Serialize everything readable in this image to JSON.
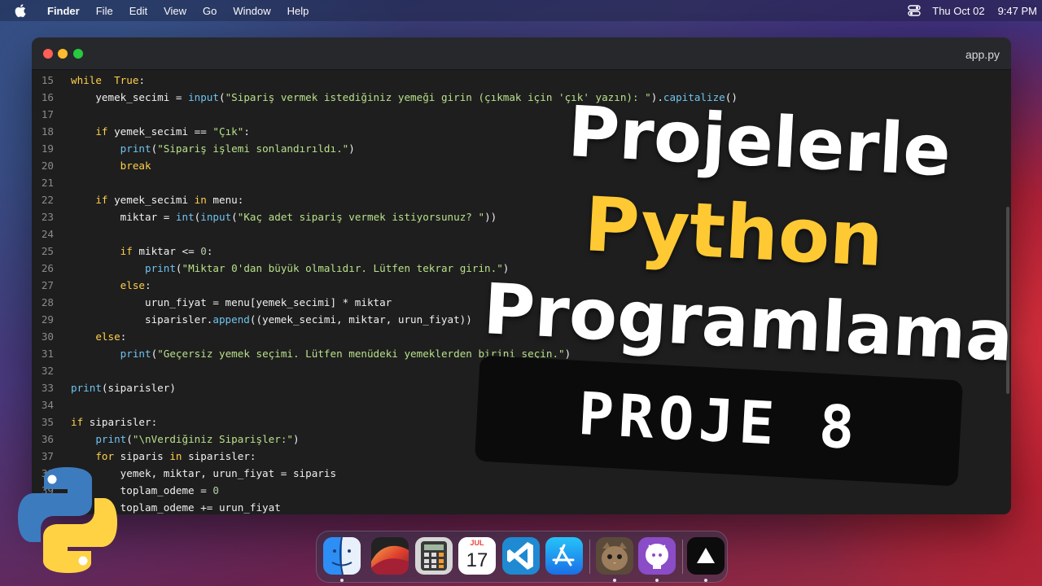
{
  "menubar": {
    "app_name": "Finder",
    "items": [
      "File",
      "Edit",
      "View",
      "Go",
      "Window",
      "Help"
    ],
    "date": "Thu Oct 02",
    "time": "9:47 PM"
  },
  "window": {
    "filename": "app.py"
  },
  "code_lines": [
    {
      "num": "15",
      "tokens": [
        [
          "kw",
          "while"
        ],
        [
          "",
          "  "
        ],
        [
          "kw",
          "True"
        ],
        [
          "",
          ":"
        ]
      ]
    },
    {
      "num": "16",
      "tokens": [
        [
          "",
          "    yemek_secimi = "
        ],
        [
          "fn",
          "input"
        ],
        [
          "",
          "("
        ],
        [
          "str",
          "\"Sipariş vermek istediğiniz yemeği girin (çıkmak için 'çık' yazın): \""
        ],
        [
          "",
          ")."
        ],
        [
          "fn",
          "capitalize"
        ],
        [
          "",
          "()"
        ]
      ]
    },
    {
      "num": "17",
      "tokens": []
    },
    {
      "num": "18",
      "tokens": [
        [
          "",
          "    "
        ],
        [
          "kw",
          "if"
        ],
        [
          "",
          " yemek_secimi == "
        ],
        [
          "str",
          "\"Çık\""
        ],
        [
          "",
          ":"
        ]
      ]
    },
    {
      "num": "19",
      "tokens": [
        [
          "",
          "        "
        ],
        [
          "fn",
          "print"
        ],
        [
          "",
          "("
        ],
        [
          "str",
          "\"Sipariş işlemi sonlandırıldı.\""
        ],
        [
          "",
          ")"
        ]
      ]
    },
    {
      "num": "20",
      "tokens": [
        [
          "",
          "        "
        ],
        [
          "kw",
          "break"
        ]
      ]
    },
    {
      "num": "21",
      "tokens": []
    },
    {
      "num": "22",
      "tokens": [
        [
          "",
          "    "
        ],
        [
          "kw",
          "if"
        ],
        [
          "",
          " yemek_secimi "
        ],
        [
          "kw",
          "in"
        ],
        [
          "",
          " menu:"
        ]
      ]
    },
    {
      "num": "23",
      "tokens": [
        [
          "",
          "        miktar = "
        ],
        [
          "fn",
          "int"
        ],
        [
          "",
          "("
        ],
        [
          "fn",
          "input"
        ],
        [
          "",
          "("
        ],
        [
          "str",
          "\"Kaç adet sipariş vermek istiyorsunuz? \""
        ],
        [
          "",
          "))"
        ]
      ]
    },
    {
      "num": "24",
      "tokens": []
    },
    {
      "num": "25",
      "tokens": [
        [
          "",
          "        "
        ],
        [
          "kw",
          "if"
        ],
        [
          "",
          " miktar <= "
        ],
        [
          "num",
          "0"
        ],
        [
          "",
          ":"
        ]
      ]
    },
    {
      "num": "26",
      "tokens": [
        [
          "",
          "            "
        ],
        [
          "fn",
          "print"
        ],
        [
          "",
          "("
        ],
        [
          "str",
          "\"Miktar 0'dan büyük olmalıdır. Lütfen tekrar girin.\""
        ],
        [
          "",
          ")"
        ]
      ]
    },
    {
      "num": "27",
      "tokens": [
        [
          "",
          "        "
        ],
        [
          "kw",
          "else"
        ],
        [
          "",
          ":"
        ]
      ]
    },
    {
      "num": "28",
      "tokens": [
        [
          "",
          "            urun_fiyat = menu[yemek_secimi] * miktar"
        ]
      ]
    },
    {
      "num": "29",
      "tokens": [
        [
          "",
          "            siparisler."
        ],
        [
          "fn",
          "append"
        ],
        [
          "",
          "((yemek_secimi, miktar, urun_fiyat))"
        ]
      ]
    },
    {
      "num": "30",
      "tokens": [
        [
          "",
          "    "
        ],
        [
          "kw",
          "else"
        ],
        [
          "",
          ":"
        ]
      ]
    },
    {
      "num": "31",
      "tokens": [
        [
          "",
          "        "
        ],
        [
          "fn",
          "print"
        ],
        [
          "",
          "("
        ],
        [
          "str",
          "\"Geçersiz yemek seçimi. Lütfen menüdeki yemeklerden birini seçin.\""
        ],
        [
          "",
          ")"
        ]
      ]
    },
    {
      "num": "32",
      "tokens": []
    },
    {
      "num": "33",
      "tokens": [
        [
          "fn",
          "print"
        ],
        [
          "",
          "(siparisler)"
        ]
      ]
    },
    {
      "num": "34",
      "tokens": []
    },
    {
      "num": "35",
      "tokens": [
        [
          "kw",
          "if"
        ],
        [
          "",
          " siparisler:"
        ]
      ]
    },
    {
      "num": "36",
      "tokens": [
        [
          "",
          "    "
        ],
        [
          "fn",
          "print"
        ],
        [
          "",
          "("
        ],
        [
          "str",
          "\"\\nVerdiğiniz Siparişler:\""
        ],
        [
          "",
          ")"
        ]
      ]
    },
    {
      "num": "37",
      "tokens": [
        [
          "",
          "    "
        ],
        [
          "kw",
          "for"
        ],
        [
          "",
          " siparis "
        ],
        [
          "kw",
          "in"
        ],
        [
          "",
          " siparisler:"
        ]
      ]
    },
    {
      "num": "38",
      "tokens": [
        [
          "",
          "        yemek, miktar, urun_fiyat = siparis"
        ]
      ]
    },
    {
      "num": "39",
      "tokens": [
        [
          "",
          "        toplam_odeme = "
        ],
        [
          "num",
          "0"
        ]
      ]
    },
    {
      "num": "40",
      "tokens": [
        [
          "",
          "        toplam_odeme += urun_fiyat"
        ]
      ]
    }
  ],
  "overlay": {
    "line1": "Projelerle",
    "line2": "Python",
    "line3": "Programlama",
    "badge": "PROJE 8"
  },
  "dock": {
    "calendar_month": "JUL",
    "calendar_day": "17"
  },
  "colors": {
    "accent_yellow": "#ffc934",
    "keyword": "#ffd04a",
    "function": "#6fc4f0",
    "string": "#b8e08a"
  }
}
